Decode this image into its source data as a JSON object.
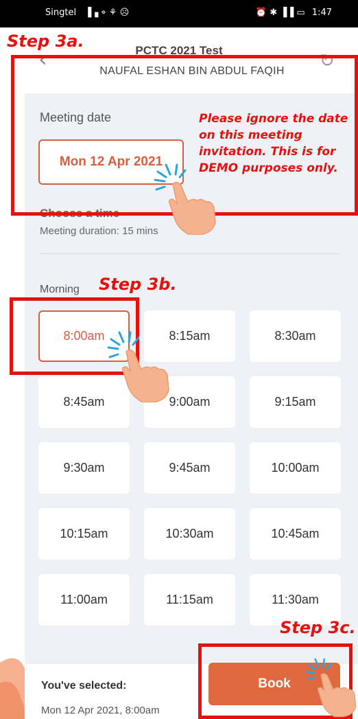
{
  "status_bar": {
    "carrier": "Singtel",
    "indicators": "▐▗ ⌖ ⚘ ☹",
    "right_icons": "⏰ ✱ ▐▐ ▭",
    "time": "1:47"
  },
  "header": {
    "title": "PCTC 2021 Test",
    "subtitle": "NAUFAL ESHAN BIN ABDUL FAQIH",
    "back_icon": "‹",
    "refresh_icon": "↻"
  },
  "meeting": {
    "date_label": "Meeting date",
    "date_value": "Mon 12 Apr 2021",
    "choose_label": "Choose a time",
    "duration_label": "Meeting duration: 15 mins"
  },
  "morning": {
    "label": "Morning",
    "slots": [
      "8:00am",
      "8:15am",
      "8:30am",
      "8:45am",
      "9:00am",
      "9:15am",
      "9:30am",
      "9:45am",
      "10:00am",
      "10:15am",
      "10:30am",
      "10:45am",
      "11:00am",
      "11:15am",
      "11:30am"
    ],
    "selected": "8:00am"
  },
  "footer": {
    "selected_label": "You've selected:",
    "selected_value": "Mon 12 Apr 2021, 8:00am",
    "book_label": "Book"
  },
  "annotations": {
    "step_3a": "Step 3a.",
    "step_3b": "Step 3b.",
    "step_3c": "Step 3c.",
    "note": "Please ignore the date on this meeting invitation. This is for DEMO purposes only."
  },
  "colors": {
    "accent": "#d95d3f",
    "book_button": "#e0683e",
    "annotation_red": "#e8100d",
    "content_bg": "#eef1f6"
  }
}
